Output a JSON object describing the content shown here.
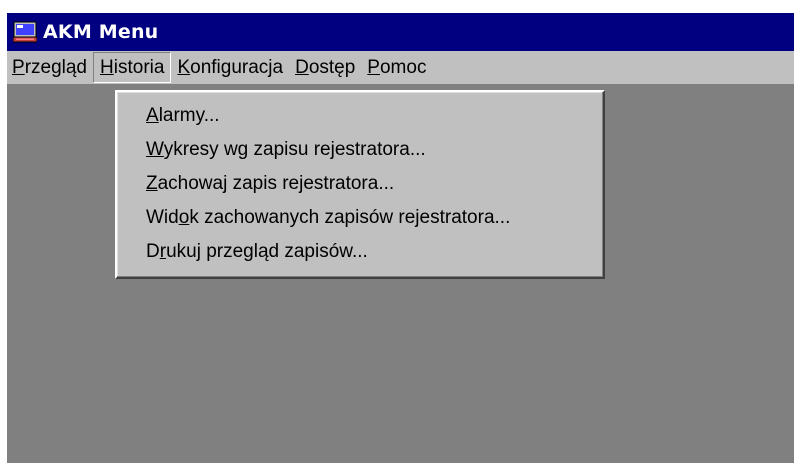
{
  "window": {
    "title": "AKM Menu",
    "icon": "computer-monitor-icon"
  },
  "menubar": {
    "items": [
      {
        "pre": "",
        "mn": "P",
        "post": "rzegląd"
      },
      {
        "pre": "",
        "mn": "H",
        "post": "istoria"
      },
      {
        "pre": "",
        "mn": "K",
        "post": "onfiguracja"
      },
      {
        "pre": "",
        "mn": "D",
        "post": "ostęp"
      },
      {
        "pre": "",
        "mn": "P",
        "post": "omoc"
      }
    ],
    "active_index": 1
  },
  "dropdown": {
    "items": [
      {
        "pre": "",
        "mn": "A",
        "post": "larmy..."
      },
      {
        "pre": "",
        "mn": "W",
        "post": "ykresy wg zapisu rejestratora..."
      },
      {
        "pre": "",
        "mn": "Z",
        "post": "achowaj zapis rejestratora..."
      },
      {
        "pre": "Wid",
        "mn": "o",
        "post": "k zachowanych zapisów rejestratora..."
      },
      {
        "pre": "D",
        "mn": "r",
        "post": "ukuj przegląd zapisów..."
      }
    ]
  },
  "colors": {
    "titlebar": "#000080",
    "face": "#c0c0c0",
    "client": "#808080"
  }
}
